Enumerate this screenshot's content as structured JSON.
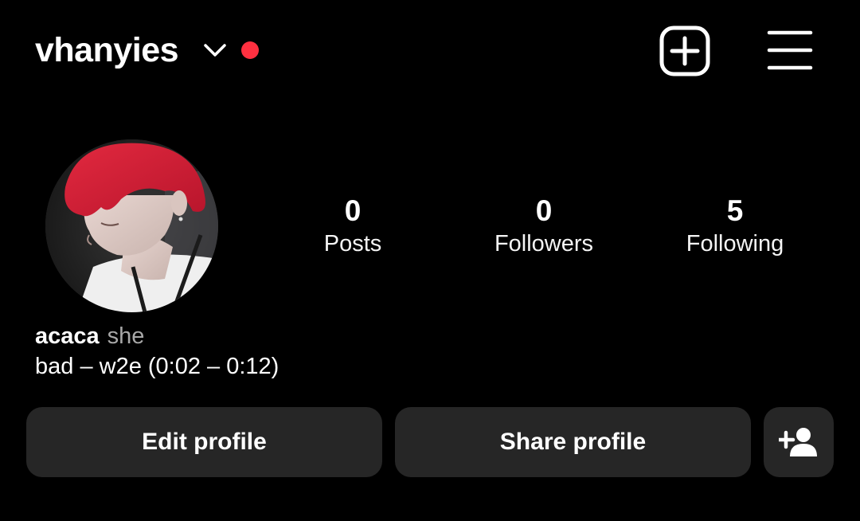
{
  "header": {
    "username": "vhanyies",
    "chevron_icon": "chevron-down-icon",
    "notification_dot_color": "#ff3040",
    "create_icon": "plus-square-icon",
    "menu_icon": "hamburger-menu-icon"
  },
  "profile": {
    "avatar_icon": "profile-photo",
    "stats": [
      {
        "count": "0",
        "label": "Posts"
      },
      {
        "count": "0",
        "label": "Followers"
      },
      {
        "count": "5",
        "label": "Following"
      }
    ],
    "display_name": "acaca",
    "pronouns": "she",
    "bio": "bad – w2e (0:02 – 0:12)"
  },
  "actions": {
    "edit_label": "Edit profile",
    "share_label": "Share profile",
    "add_icon": "add-person-icon"
  },
  "colors": {
    "background": "#000000",
    "button_bg": "#262626",
    "text": "#ffffff",
    "muted_text": "#a8a8a8",
    "accent_red": "#ff3040"
  }
}
